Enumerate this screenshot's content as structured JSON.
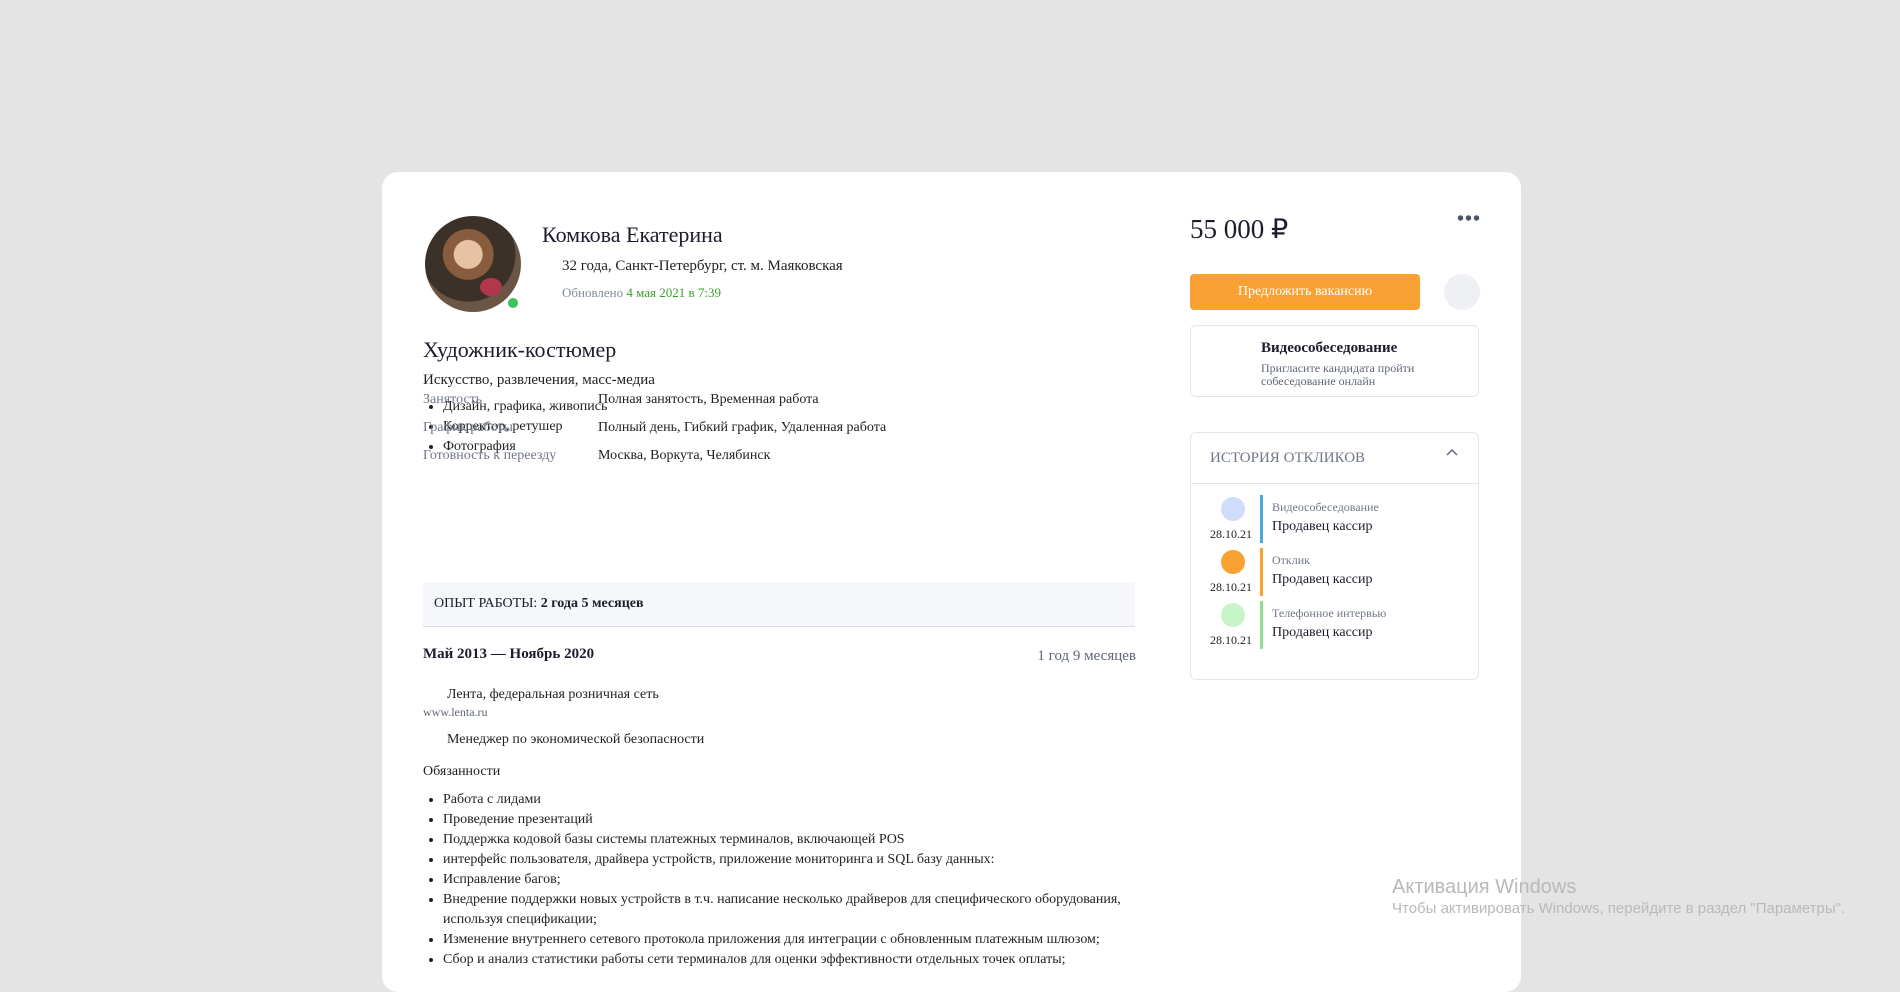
{
  "candidate": {
    "name": "Комкова Екатерина",
    "meta": "32 года, Санкт-Петербург, ст. м. Маяковская",
    "updated_prefix": "Обновлено ",
    "updated_date": "4 мая 2021 в 7:39"
  },
  "resume": {
    "title": "Художник-костюмер",
    "industry": "Искусство, развлечения, масс-медиа",
    "specializations": [
      "Дизайн, графика, живопись",
      "Корректор, ретушер",
      "Фотография"
    ],
    "details": [
      {
        "key": "Занятость",
        "value": "Полная занятость, Временная работа"
      },
      {
        "key": "График работы",
        "value": "Полный день, Гибкий график, Удаленная работа"
      },
      {
        "key": "Готовность к переезду",
        "value": "Москва, Воркута, Челябинск"
      }
    ]
  },
  "experience": {
    "label": "ОПЫТ РАБОТЫ: ",
    "total": "2 года 5 месяцев",
    "job": {
      "period": "Май 2013 — Ноябрь 2020",
      "duration": "1 год 9 месяцев",
      "company": "Лента, федеральная розничная сеть",
      "site": "www.lenta.ru",
      "position": "Менеджер по экономической безопасности",
      "duties_heading": "Обязанности",
      "duties": [
        "Работа с лидами",
        "Проведение презентаций",
        "Поддержка кодовой базы системы платежных терминалов, включающей POS",
        "интерфейс пользователя, драйвера устройств, приложение мониторинга и SQL базу данных:",
        "Исправление багов;",
        "Внедрение поддержки новых устройств в т.ч. написание несколько драйверов для специфического оборудования, используя спецификации;",
        "Изменение внутреннего сетевого протокола приложения для интеграции с обновленным платежным шлюзом;",
        "Сбор и анализ статистики работы сети терминалов для оценки эффективности отдельных точек оплаты;"
      ]
    }
  },
  "sidebar": {
    "salary": "55 000 ₽",
    "more_label": "•••",
    "offer_button": "Предложить вакансию",
    "video": {
      "title": "Видеособеседование",
      "description": "Пригласите кандидата пройти собеседование онлайн"
    },
    "history": {
      "title": "ИСТОРИЯ ОТКЛИКОВ",
      "items": [
        {
          "date": "28.10.21",
          "type": "Видеособеседование",
          "vacancy": "Продавец кассир",
          "dot_color": "#cfdcfb",
          "bar_color": "#4aa8e0"
        },
        {
          "date": "28.10.21",
          "type": "Отклик",
          "vacancy": "Продавец кассир",
          "dot_color": "#f9a133",
          "bar_color": "#f9a133"
        },
        {
          "date": "28.10.21",
          "type": "Телефонное интервью",
          "vacancy": "Продавец кассир",
          "dot_color": "#c8f5c8",
          "bar_color": "#8ee08e"
        }
      ]
    }
  },
  "watermark": {
    "line1": "Активация Windows",
    "line2": "Чтобы активировать Windows, перейдите в раздел \"Параметры\"."
  }
}
